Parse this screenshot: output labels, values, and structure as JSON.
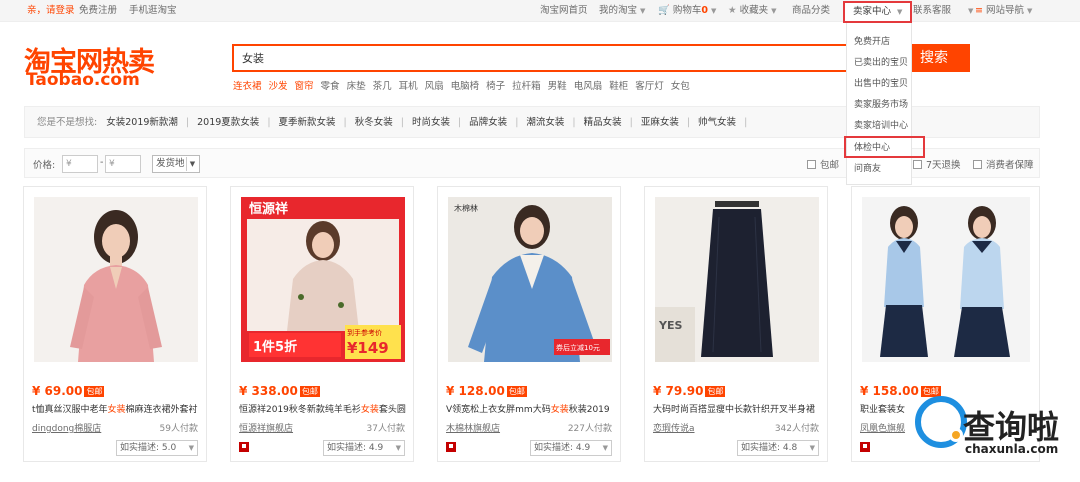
{
  "topbar": {
    "greeting": "亲，请登录",
    "register": "免费注册",
    "mobile": "手机逛淘宝",
    "home": "淘宝网首页",
    "my_taobao": "我的淘宝",
    "cart_icon": "cart-icon",
    "cart_label": "购物车",
    "cart_count": "0",
    "favorites_icon": "star-icon",
    "favorites": "收藏夹",
    "categories": "商品分类",
    "seller_center": "卖家中心",
    "contact": "联系客服",
    "nav_icon": "menu-icon",
    "site_nav": "网站导航"
  },
  "seller_menu": {
    "items": [
      "免费开店",
      "已卖出的宝贝",
      "出售中的宝贝",
      "卖家服务市场",
      "卖家培训中心",
      "体检中心",
      "问商友"
    ]
  },
  "logo": {
    "cn": "淘宝网热卖",
    "en": "Taobao.com"
  },
  "search": {
    "value": "女装",
    "button": "搜索"
  },
  "hotwords": [
    {
      "text": "连衣裙",
      "hl": true
    },
    {
      "text": "沙发",
      "hl": true
    },
    {
      "text": "窗帘",
      "hl": true
    },
    {
      "text": "零食",
      "hl": false
    },
    {
      "text": "床垫",
      "hl": false
    },
    {
      "text": "茶几",
      "hl": false
    },
    {
      "text": "耳机",
      "hl": false
    },
    {
      "text": "风扇",
      "hl": false
    },
    {
      "text": "电脑椅",
      "hl": false
    },
    {
      "text": "椅子",
      "hl": false
    },
    {
      "text": "拉杆箱",
      "hl": false
    },
    {
      "text": "男鞋",
      "hl": false
    },
    {
      "text": "电风扇",
      "hl": false
    },
    {
      "text": "鞋柜",
      "hl": false
    },
    {
      "text": "客厅灯",
      "hl": false
    },
    {
      "text": "女包",
      "hl": false
    }
  ],
  "suggest": {
    "label": "您是不是想找:",
    "items": [
      "女装2019新款潮",
      "2019夏款女装",
      "夏季新款女装",
      "秋冬女装",
      "时尚女装",
      "品牌女装",
      "潮流女装",
      "精品女装",
      "亚麻女装",
      "帅气女装"
    ]
  },
  "filters": {
    "price_label": "价格:",
    "currency": "¥",
    "dash": "-",
    "ship_from": "发货地",
    "baoyou": "包邮",
    "seven_day": "7天退换",
    "consumer": "消费者保障"
  },
  "products": [
    {
      "price": "¥ 69.00",
      "tag": "包邮",
      "title_pre": "t恤真丝汉服中老年",
      "title_kw": "女装",
      "title_post": "棉麻连衣裙外套衬",
      "shop": "dingdong棉服店",
      "sold": "59人付款",
      "rating": "如实描述: 5.0",
      "has_tm": false
    },
    {
      "price": "¥ 338.00",
      "tag": "包邮",
      "title_pre": "恒源祥2019秋冬新款纯羊毛衫",
      "title_kw": "女装",
      "title_post": "套头圆",
      "shop": "恒源祥旗舰店",
      "sold": "37人付款",
      "rating": "如实描述: 4.9",
      "has_tm": true
    },
    {
      "price": "¥ 128.00",
      "tag": "包邮",
      "title_pre": "V领宽松上衣女胖mm大码",
      "title_kw": "女装",
      "title_post": "秋装2019",
      "shop": "木棉林旗舰店",
      "sold": "227人付款",
      "rating": "如实描述: 4.9",
      "has_tm": true
    },
    {
      "price": "¥ 79.90",
      "tag": "包邮",
      "title_pre": "大码时尚百搭显瘦中长款针织开叉半身裙",
      "title_kw": "",
      "title_post": "",
      "shop": "恋瑕传说a",
      "sold": "342人付款",
      "rating": "如实描述: 4.8",
      "has_tm": false
    },
    {
      "price": "¥ 158.00",
      "tag": "包邮",
      "title_pre": "职业套装女",
      "title_kw": "",
      "title_post": "",
      "shop": "凤凰色旗舰",
      "sold": "",
      "rating": "",
      "has_tm": true
    }
  ],
  "product_images": {
    "p2_brand": "恒源祥",
    "p2_promo_a": "1件5折",
    "p2_promo_b": "¥149",
    "p2_badge": "到手参考价",
    "p3_brand": "木棉林",
    "p3_badge": "券后立减10元",
    "p4_text": "YES"
  },
  "watermark": {
    "cn": "查询啦",
    "en": "chaxunla.com"
  },
  "colors": {
    "accent": "#ff4400",
    "highlight_box": "#e4393c",
    "watermark_blue": "#1e8fe0"
  }
}
